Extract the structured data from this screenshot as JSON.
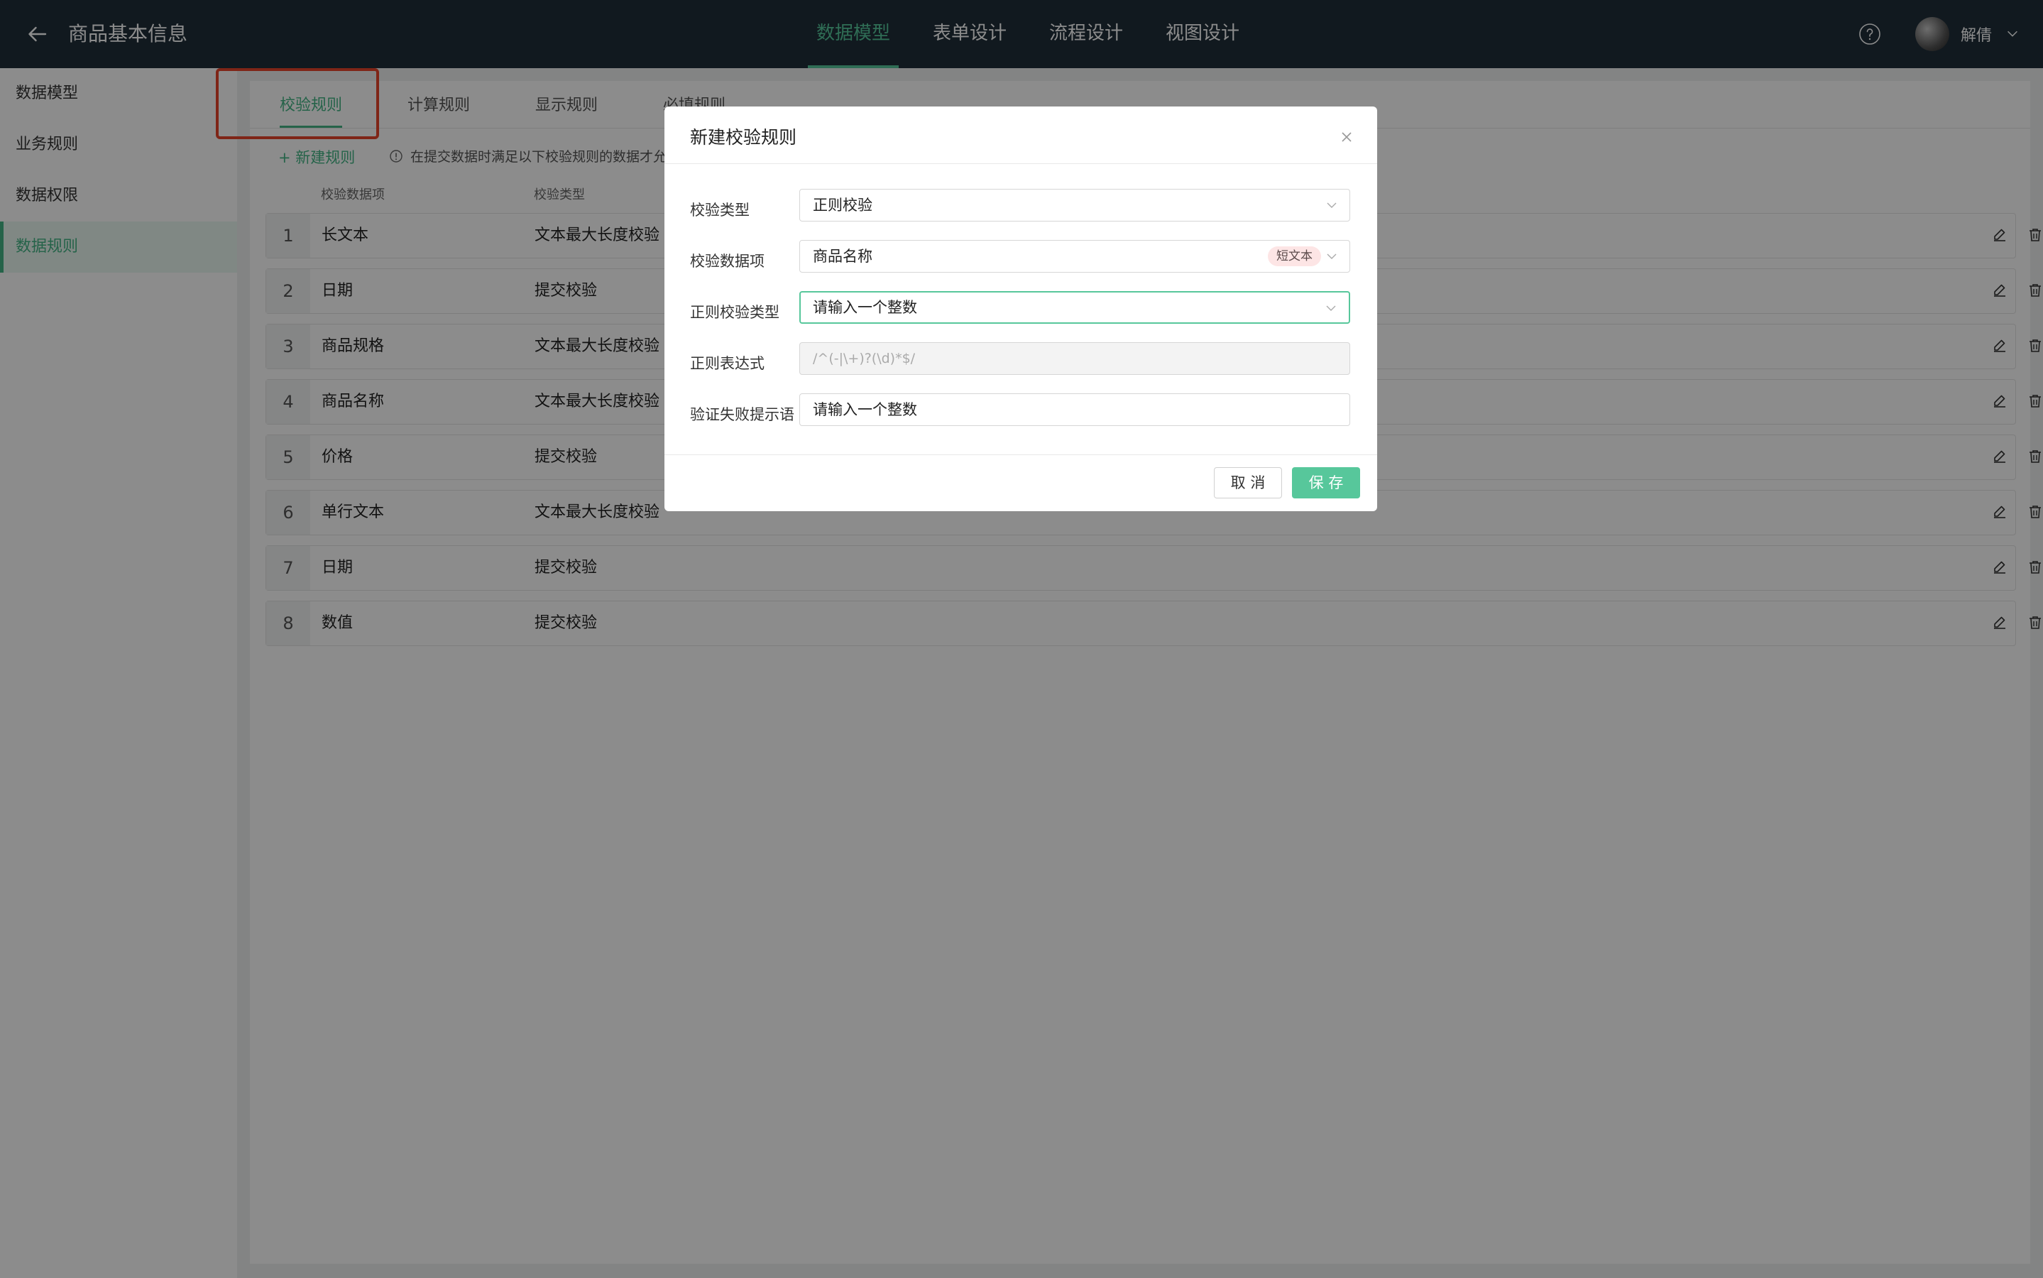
{
  "header": {
    "title": "商品基本信息",
    "nav": [
      "数据模型",
      "表单设计",
      "流程设计",
      "视图设计"
    ],
    "active_nav": "数据模型",
    "username": "解倩"
  },
  "sidebar": {
    "items": [
      {
        "label": "数据模型"
      },
      {
        "label": "业务规则"
      },
      {
        "label": "数据权限"
      },
      {
        "label": "数据规则",
        "active": true
      }
    ]
  },
  "tabs": [
    {
      "label": "校验规则",
      "active": true
    },
    {
      "label": "计算规则"
    },
    {
      "label": "显示规则"
    },
    {
      "label": "必填规则"
    }
  ],
  "toolbar": {
    "new_rule": "+ 新建规则",
    "hint": "在提交数据时满足以下校验规则的数据才允许"
  },
  "table": {
    "columns": [
      "校验数据项",
      "校验类型"
    ],
    "rows": [
      {
        "num": "1",
        "field": "长文本",
        "type": "文本最大长度校验"
      },
      {
        "num": "2",
        "field": "日期",
        "type": "提交校验"
      },
      {
        "num": "3",
        "field": "商品规格",
        "type": "文本最大长度校验"
      },
      {
        "num": "4",
        "field": "商品名称",
        "type": "文本最大长度校验"
      },
      {
        "num": "5",
        "field": "价格",
        "type": "提交校验"
      },
      {
        "num": "6",
        "field": "单行文本",
        "type": "文本最大长度校验"
      },
      {
        "num": "7",
        "field": "日期",
        "type": "提交校验"
      },
      {
        "num": "8",
        "field": "数值",
        "type": "提交校验"
      }
    ]
  },
  "modal": {
    "title": "新建校验规则",
    "fields": {
      "check_type": {
        "label": "校验类型",
        "value": "正则校验"
      },
      "data_item": {
        "label": "校验数据项",
        "value": "商品名称",
        "tag": "短文本"
      },
      "regex_type": {
        "label": "正则校验类型",
        "value": "请输入一个整数"
      },
      "regex": {
        "label": "正则表达式",
        "value": "/^(-|\\+)?(\\d)*$/"
      },
      "error_msg": {
        "label": "验证失败提示语",
        "value": "请输入一个整数"
      }
    },
    "cancel_label": "取 消",
    "save_label": "保 存"
  },
  "colors": {
    "accent": "#57c79b",
    "topbar": "#1f2f3a",
    "highlight": "#e8442b",
    "tag_bg": "#fde5e5"
  }
}
